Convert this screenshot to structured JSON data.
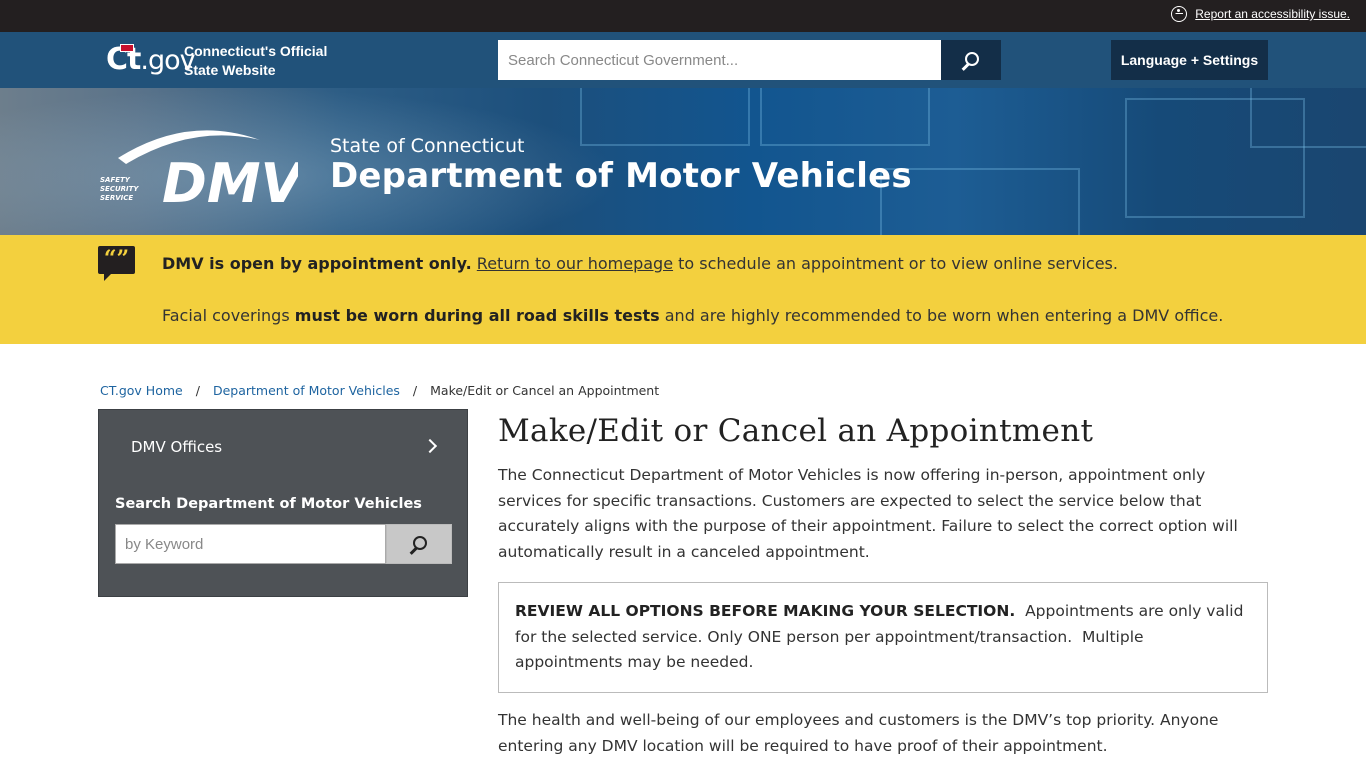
{
  "topbar": {
    "accessibility_link": "Report an accessibility issue."
  },
  "govbar": {
    "logo_ct": "Ct",
    "logo_gov": ".gov",
    "official_line1": "Connecticut's Official",
    "official_line2": "State Website",
    "search_placeholder": "Search Connecticut Government...",
    "language_button": "Language + Settings"
  },
  "banner": {
    "logo_text": "DMV",
    "logo_tagline": [
      "SAFETY",
      "SECURITY",
      "SERVICE"
    ],
    "subtitle": "State of Connecticut",
    "title": "Department of Motor Vehicles"
  },
  "alert": {
    "line1_bold": "DMV is open by appointment only.",
    "line1_link": "Return to our homepage",
    "line1_rest": " to schedule an appointment or to view online services.",
    "line2_pre": "Facial coverings ",
    "line2_bold": "must be worn during all road skills tests",
    "line2_post": " and are highly recommended to be worn when entering a DMV office."
  },
  "breadcrumb": {
    "home": "CT.gov Home",
    "sep1": "/",
    "dept": "Department of Motor Vehicles",
    "sep2": "/",
    "current": "Make/Edit or Cancel an Appointment"
  },
  "sidebar": {
    "offices_label": "DMV Offices",
    "search_label": "Search Department of Motor Vehicles",
    "search_placeholder": "by Keyword"
  },
  "main": {
    "title": "Make/Edit or Cancel an Appointment",
    "intro": "The Connecticut Department of Motor Vehicles is now offering in-person, appointment only services for specific transactions. Customers are expected to select the service below that accurately aligns with the purpose of their appointment. Failure to select the correct option will automatically result in a canceled appointment.",
    "review_bold": "REVIEW ALL OPTIONS BEFORE MAKING YOUR SELECTION.",
    "review_rest": "  Appointments are only valid for the selected service. Only ONE person per appointment/transaction.  Multiple appointments may be needed.",
    "health": "The health and well-being of our employees and customers is the DMV’s top priority. Anyone entering any DMV location will be required to have proof of their appointment."
  },
  "colors": {
    "topbar": "#231f20",
    "govbar": "#21527a",
    "button_dark": "#132e48",
    "alert_yellow": "#f3d03e",
    "sidebar": "#4e5256",
    "link": "#1e64a0"
  }
}
